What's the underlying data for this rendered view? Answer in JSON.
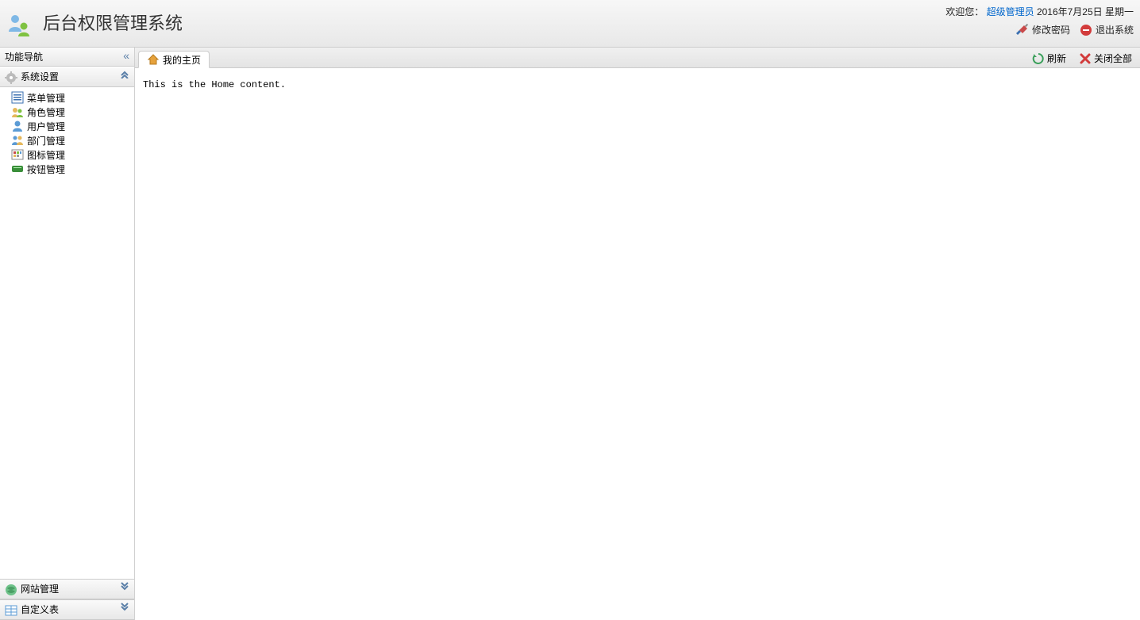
{
  "header": {
    "app_title": "后台权限管理系统",
    "welcome_prefix": "欢迎您：",
    "user_name": "超级管理员",
    "date_text": "2016年7月25日  星期一",
    "change_password": "修改密码",
    "logout": "退出系统"
  },
  "sidebar": {
    "title": "功能导航",
    "panels": {
      "system": {
        "title": "系统设置",
        "expanded": true
      },
      "site": {
        "title": "网站管理",
        "expanded": false
      },
      "custom": {
        "title": "自定义表",
        "expanded": false
      }
    },
    "system_items": [
      {
        "icon": "menu-icon",
        "label": "菜单管理"
      },
      {
        "icon": "role-icon",
        "label": "角色管理"
      },
      {
        "icon": "user-icon",
        "label": "用户管理"
      },
      {
        "icon": "dept-icon",
        "label": "部门管理"
      },
      {
        "icon": "iconset-icon",
        "label": "图标管理"
      },
      {
        "icon": "button-icon",
        "label": "按钮管理"
      }
    ]
  },
  "main": {
    "tab_home": "我的主页",
    "refresh": "刷新",
    "close_all": "关闭全部",
    "content": "This is the Home content."
  }
}
